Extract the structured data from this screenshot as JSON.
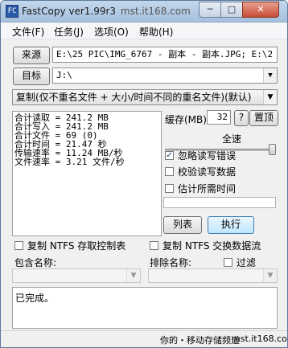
{
  "window": {
    "title": "FastCopy ver1.99r3",
    "watermark": "mst.it168.com",
    "minimize_glyph": "─",
    "maximize_glyph": "□",
    "close_glyph": "✕",
    "app_icon_glyph": "FC"
  },
  "menu": [
    {
      "label": "文件(F)"
    },
    {
      "label": "任务(J)"
    },
    {
      "label": "选项(O)"
    },
    {
      "label": "帮助(H)"
    }
  ],
  "source": {
    "button": "来源",
    "value": "E:\\25 PIC\\IMG_6767 - 副本 - 副本.JPG; E:\\2"
  },
  "target": {
    "button": "目标",
    "value": "J:\\"
  },
  "mode": {
    "selected": "复制(仅不重名文件 + 大小/时间不同的重名文件)(默认)"
  },
  "stats": [
    {
      "label": "合计读取",
      "value": "= 241.2 MB"
    },
    {
      "label": "合计写入",
      "value": "= 241.2 MB"
    },
    {
      "label": "合计文件",
      "value": "= 69 (0)"
    },
    {
      "label": "合计时间",
      "value": "= 21.47 秒"
    },
    {
      "label": "传输速率",
      "value": "= 11.24 MB/秒"
    },
    {
      "label": "文件速率",
      "value": "= 3.21 文件/秒"
    }
  ],
  "buffer": {
    "label": "缓存(MB)",
    "value": "32",
    "help": "?",
    "top_button": "置顶"
  },
  "full_speed_label": "全速",
  "speed_level": 1.0,
  "options": [
    {
      "label": "忽略读写错误",
      "checked": true
    },
    {
      "label": "校验读写数据",
      "checked": false
    },
    {
      "label": "估计所需时间",
      "checked": false
    }
  ],
  "check_mark": "✓",
  "progress": 0,
  "actions": {
    "list": "列表",
    "execute": "执行"
  },
  "ntfs": {
    "acl": "复制 NTFS 存取控制表",
    "streams": "复制 NTFS 交换数据流"
  },
  "filters": {
    "include_label": "包含名称:",
    "exclude_label": "排除名称:",
    "filter_label": "过滤",
    "dd_glyph": "▼"
  },
  "log": {
    "text": "已完成。"
  },
  "status": {
    "text": "你的・移动存储频道"
  }
}
